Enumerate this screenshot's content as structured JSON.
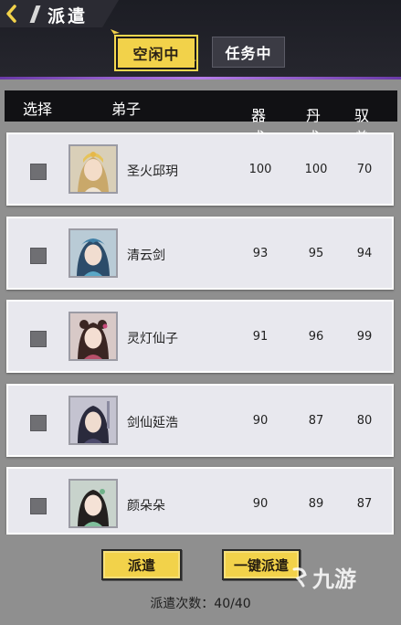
{
  "header": {
    "title": "派遣",
    "tabs": [
      {
        "label": "空闲中",
        "active": true
      },
      {
        "label": "任务中",
        "active": false
      }
    ]
  },
  "columns": {
    "select": "选择",
    "disciple": "弟子",
    "qishu": "器术",
    "qishu_mark": "⌄",
    "danshu": "丹术",
    "danshu_mark": "–",
    "yushou": "驭兽",
    "yushou_mark": "–"
  },
  "disciples": [
    {
      "name": "圣火邱玥",
      "qishu": "100",
      "danshu": "100",
      "yushou": "70",
      "checked": false
    },
    {
      "name": "清云剑",
      "qishu": "93",
      "danshu": "95",
      "yushou": "94",
      "checked": false
    },
    {
      "name": "灵灯仙子",
      "qishu": "91",
      "danshu": "96",
      "yushou": "99",
      "checked": false
    },
    {
      "name": "剑仙延浩",
      "qishu": "90",
      "danshu": "87",
      "yushou": "80",
      "checked": false
    },
    {
      "name": "颜朵朵",
      "qishu": "90",
      "danshu": "89",
      "yushou": "87",
      "checked": false
    }
  ],
  "footer": {
    "dispatch_label": "派遣",
    "onekey_label": "一键派遣",
    "count_text": "派遣次数：40/40"
  },
  "watermark": "九游",
  "colors": {
    "accent_yellow": "#f2d24a",
    "header_dark": "#1c1d24",
    "purple_line": "#b57de8",
    "row_bg": "#e8e8ee",
    "checkbox": "#6f6f73"
  }
}
